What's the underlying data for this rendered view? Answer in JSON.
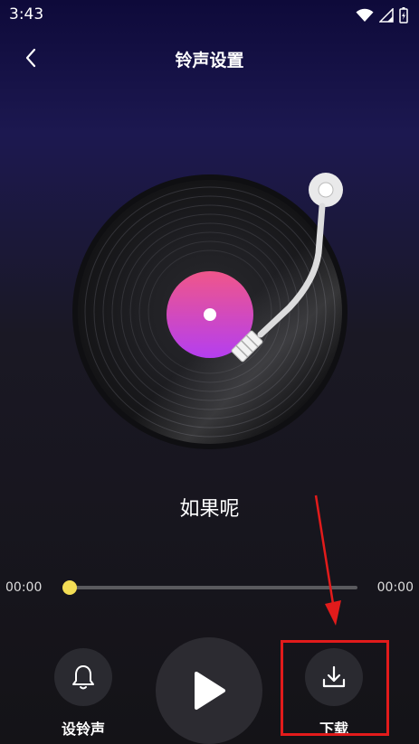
{
  "status_bar": {
    "time": "3:43",
    "icons": [
      "wifi-icon",
      "signal-icon",
      "battery-icon"
    ]
  },
  "header": {
    "title": "铃声设置",
    "back_icon": "chevron-left-icon"
  },
  "player": {
    "song_title": "如果呢",
    "current_time": "00:00",
    "total_time": "00:00",
    "progress": 0
  },
  "controls": {
    "ringtone_label": "设铃声",
    "download_label": "下载",
    "ringtone_icon": "bell-icon",
    "play_icon": "play-icon",
    "download_icon": "download-icon"
  },
  "colors": {
    "accent_yellow": "#f3dd55",
    "label_pink": "#f0568a",
    "label_purple": "#b43ef0",
    "annotation_red": "#e21b1b"
  }
}
